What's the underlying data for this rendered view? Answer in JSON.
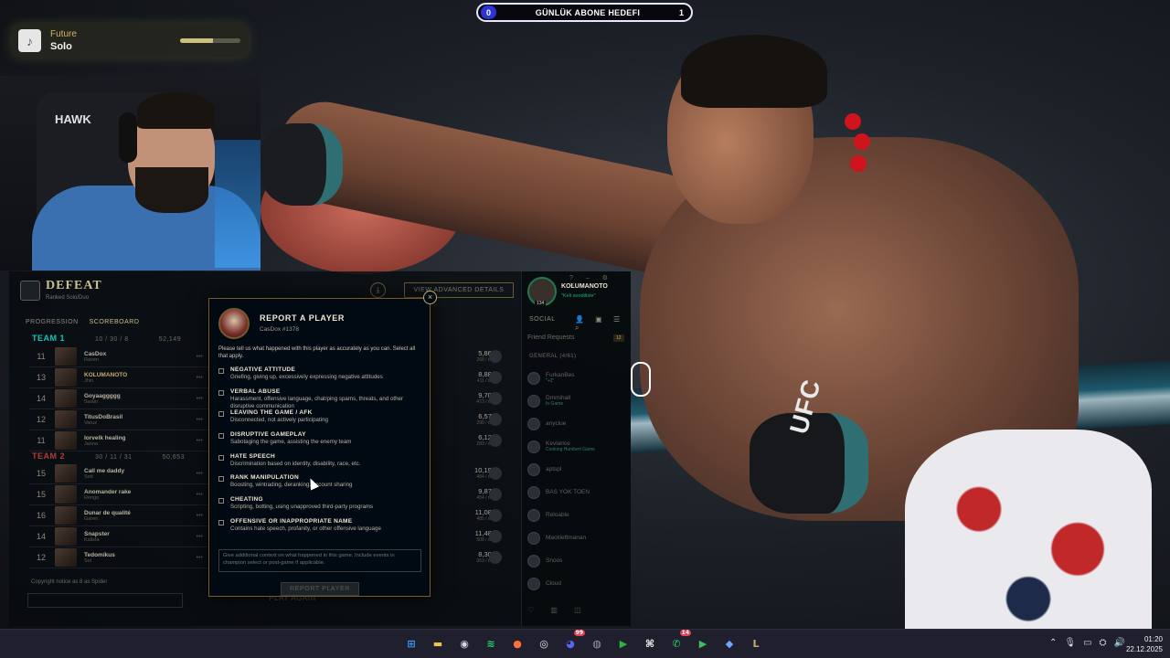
{
  "overlay": {
    "goal_left_count": "0",
    "goal_title": "GÜNLÜK ABONE HEDEFI",
    "goal_right_count": "1",
    "music_artist": "Future",
    "music_song": "Solo",
    "music_progress": 0.55
  },
  "webcam": {
    "chair_logo": "HAWK"
  },
  "postgame": {
    "result": "DEFEAT",
    "subtitle": "Ranked Solo/Duo",
    "tabs": [
      "PROGRESSION",
      "SCOREBOARD"
    ],
    "advanced_details_button": "VIEW ADVANCED DETAILS",
    "download_icon": "download-icon",
    "team1": {
      "label": "TEAM 1",
      "kda": "10 / 30 / 8",
      "gold": "52,149",
      "players": [
        {
          "level": "11",
          "name": "CasDox",
          "sub": "Raven"
        },
        {
          "level": "13",
          "name": "KOLUMANOTO",
          "sub": "Jhin"
        },
        {
          "level": "14",
          "name": "Goyaaggggg",
          "sub": "Swain"
        },
        {
          "level": "12",
          "name": "TitusDoBrasil",
          "sub": "Varus"
        },
        {
          "level": "11",
          "name": "lorvelk healing",
          "sub": "Janna"
        }
      ]
    },
    "team2": {
      "label": "TEAM 2",
      "kda": "30 / 11 / 31",
      "gold": "50,653",
      "players": [
        {
          "level": "15",
          "name": "Call me daddy",
          "sub": "Sett"
        },
        {
          "level": "15",
          "name": "Anomander rake",
          "sub": "Rengo"
        },
        {
          "level": "16",
          "name": "Dunar de qualité",
          "sub": "Garen"
        },
        {
          "level": "14",
          "name": "Snapster",
          "sub": "Kalista"
        },
        {
          "level": "12",
          "name": "Tedomikus",
          "sub": "Sol"
        }
      ]
    },
    "damage_team1": [
      {
        "value": "5,864",
        "sub": "268 / min"
      },
      {
        "value": "8,887",
        "sub": "411 / min"
      },
      {
        "value": "9,700",
        "sub": "473 / min"
      },
      {
        "value": "6,570",
        "sub": "290 / min"
      },
      {
        "value": "6,127",
        "sub": "283 / min"
      }
    ],
    "damage_team2": [
      {
        "value": "10,191",
        "sub": "484 / min"
      },
      {
        "value": "9,875",
        "sub": "454 / min"
      },
      {
        "value": "11,085",
        "sub": "485 / min"
      },
      {
        "value": "11,482",
        "sub": "508 / min"
      },
      {
        "value": "8,300",
        "sub": "353 / min"
      }
    ],
    "chat_message": "Copyright notice as 8 as Spider",
    "play_again": "PLAY AGAIN"
  },
  "social": {
    "name": "KOLUMANOTO",
    "status": "\"Keli sondiliste\"",
    "level": "134",
    "title": "SOCIAL",
    "friend_requests": "Friend Requests",
    "friend_requests_count": "12",
    "group": "GENERAL (4/61)",
    "friends": [
      {
        "name": "FurkanBes",
        "status": "\"+2\""
      },
      {
        "name": "Dmmihall",
        "status": "In Game"
      },
      {
        "name": "anyclue",
        "status": ""
      },
      {
        "name": "Kevlarice",
        "status": "Cooking Humbert Game"
      },
      {
        "name": "aptspl",
        "status": ""
      },
      {
        "name": "BAS YOK TOEN",
        "status": ""
      },
      {
        "name": "Reloable",
        "status": ""
      },
      {
        "name": "Mackleftmanan",
        "status": ""
      },
      {
        "name": "Snoos",
        "status": ""
      },
      {
        "name": "Cloud",
        "status": ""
      }
    ]
  },
  "report": {
    "title": "REPORT A PLAYER",
    "player": "CasDox #1378",
    "instructions": "Please tell us what happened with this player as accurately as you can. Select all that apply.",
    "options": [
      {
        "label": "NEGATIVE ATTITUDE",
        "desc": "Griefing, giving up, excessively expressing negative attitudes"
      },
      {
        "label": "VERBAL ABUSE",
        "desc": "Harassment, offensive language, chat/ping spams, threats, and other disruptive communication"
      },
      {
        "label": "LEAVING THE GAME / AFK",
        "desc": "Disconnected, not actively participating"
      },
      {
        "label": "DISRUPTIVE GAMEPLAY",
        "desc": "Sabotaging the game, assisting the enemy team"
      },
      {
        "label": "HATE SPEECH",
        "desc": "Discrimination based on identity, disability, race, etc."
      },
      {
        "label": "RANK MANIPULATION",
        "desc": "Boosting, wintrading, deranking, account sharing"
      },
      {
        "label": "CHEATING",
        "desc": "Scripting, botting, using unapproved third-party programs"
      },
      {
        "label": "OFFENSIVE OR INAPPROPRIATE NAME",
        "desc": "Contains hate speech, profanity, or other offensive language"
      }
    ],
    "textarea_placeholder": "Give additional context on what happened in this game. Include events in champion select or post-game if applicable.",
    "submit": "REPORT PLAYER",
    "close": "×"
  },
  "background": {
    "glove_text": "UFC"
  },
  "taskbar": {
    "apps": [
      {
        "icon": "windows-start-icon",
        "glyph": "⊞",
        "color": "#3a9bff"
      },
      {
        "icon": "file-explorer-icon",
        "glyph": "▬",
        "color": "#f2c14e"
      },
      {
        "icon": "steam-icon",
        "glyph": "◉",
        "color": "#cfd8e3"
      },
      {
        "icon": "spotify-icon",
        "glyph": "≋",
        "color": "#1ed760"
      },
      {
        "icon": "firefox-icon",
        "glyph": "●",
        "color": "#ff7139"
      },
      {
        "icon": "obs-icon",
        "glyph": "◎",
        "color": "#e6e6e6"
      },
      {
        "icon": "discord-icon",
        "glyph": "◕",
        "color": "#5865f2",
        "badge": "99"
      },
      {
        "icon": "chrome-icon",
        "glyph": "◍",
        "color": "#9aa0a6"
      },
      {
        "icon": "media-player-icon",
        "glyph": "▶",
        "color": "#2fb344"
      },
      {
        "icon": "capcut-icon",
        "glyph": "⌘",
        "color": "#ffffff"
      },
      {
        "icon": "whatsapp-icon",
        "glyph": "✆",
        "color": "#25d366",
        "badge": "14"
      },
      {
        "icon": "terminal-icon",
        "glyph": "▶",
        "color": "#3fbf5a"
      },
      {
        "icon": "riot-client-icon",
        "glyph": "◆",
        "color": "#6fa8ff"
      },
      {
        "icon": "league-client-icon",
        "glyph": "L",
        "color": "#c8aa6e"
      }
    ],
    "time": "01:20",
    "date": "22.12.2025"
  }
}
